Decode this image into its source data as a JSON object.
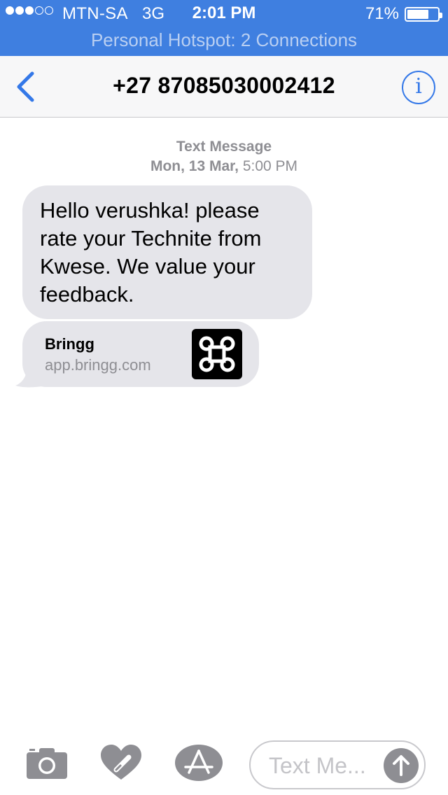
{
  "status_bar": {
    "signal_bars_filled": 3,
    "signal_bars_total": 5,
    "carrier": "MTN-SA",
    "network": "3G",
    "time": "2:01 PM",
    "battery_percent": "71%",
    "battery_level": 0.71
  },
  "hotspot_banner": "Personal Hotspot: 2 Connections",
  "navbar": {
    "back_icon": "chevron-left-icon",
    "title": "+27 87085030002412",
    "info_icon_glyph": "i"
  },
  "conversation": {
    "timestamp_kind": "Text Message",
    "timestamp_date": "Mon, 13 Mar,",
    "timestamp_time": "5:00 PM",
    "message_text": "Hello verushka! please rate your Technite from Kwese. We value your feedback.",
    "link_preview": {
      "site_name": "Bringg",
      "domain": "app.bringg.com",
      "thumbnail_icon": "bringg-logo-icon"
    }
  },
  "input_bar": {
    "camera_icon": "camera-icon",
    "digital_touch_icon": "heart-touch-icon",
    "appstore_icon": "app-store-icon",
    "placeholder": "Text Me...",
    "send_icon": "arrow-up-icon"
  },
  "colors": {
    "status_background": "#3f7fe0",
    "accent_blue": "#3478e8",
    "bubble_gray": "#e5e5ea",
    "secondary_text": "#8e8e93"
  }
}
